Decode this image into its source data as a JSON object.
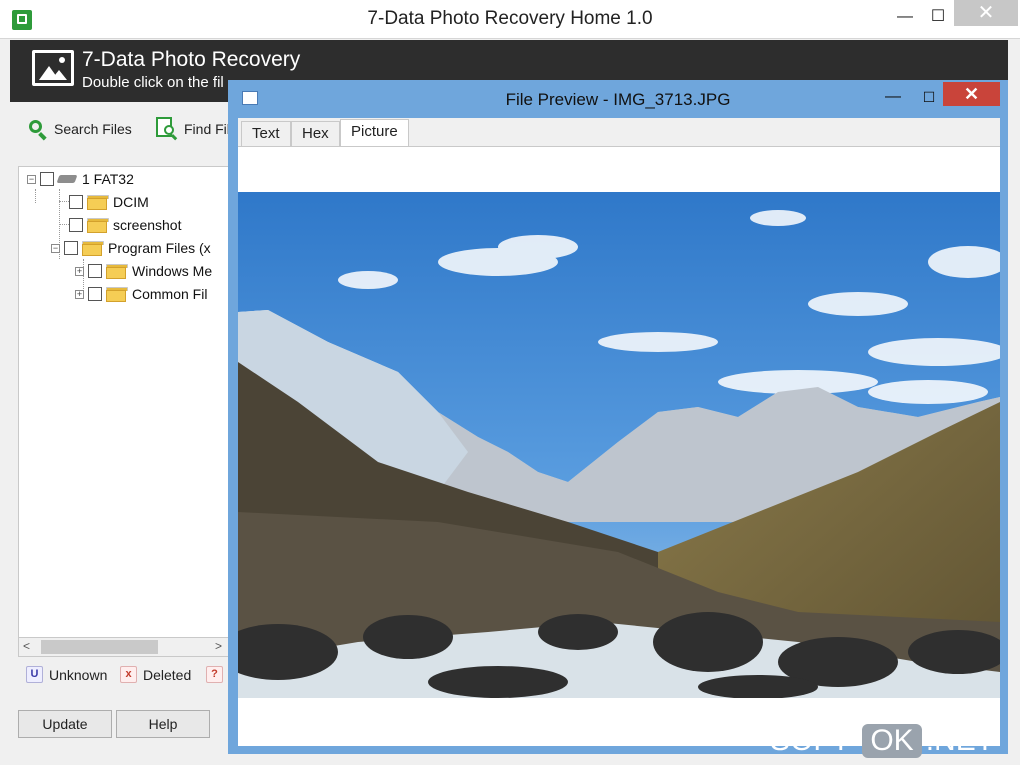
{
  "main_window": {
    "title": "7-Data Photo Recovery Home 1.0",
    "controls": {
      "minimize": "—",
      "maximize": "☐",
      "close": "✕"
    }
  },
  "banner": {
    "title": "7-Data Photo Recovery",
    "subtitle": "Double click on the fil"
  },
  "toolbar": {
    "search_files": "Search Files",
    "find_files": "Find Fil"
  },
  "tree": {
    "items": [
      {
        "label": "1 FAT32",
        "level": 0,
        "type": "drive",
        "expander": "−"
      },
      {
        "label": "DCIM",
        "level": 1,
        "type": "folder"
      },
      {
        "label": "screenshot",
        "level": 1,
        "type": "folder"
      },
      {
        "label": "Program Files (x",
        "level": 1,
        "type": "folder",
        "expander": "−"
      },
      {
        "label": "Windows Me",
        "level": 2,
        "type": "folder",
        "expander": "+"
      },
      {
        "label": "Common Fil",
        "level": 2,
        "type": "folder",
        "expander": "+"
      }
    ]
  },
  "scrollbar": {
    "left_arrow": "<",
    "right_arrow": ">"
  },
  "legend": {
    "unknown": {
      "badge": "U",
      "label": "Unknown",
      "color": "#3a3aa8"
    },
    "deleted": {
      "badge": "x",
      "label": "Deleted",
      "color": "#c23a2a"
    },
    "other": {
      "badge": "?",
      "color": "#c23a2a"
    }
  },
  "buttons": {
    "update": "Update",
    "help": "Help"
  },
  "preview_window": {
    "title": "File Preview - IMG_3713.JPG",
    "controls": {
      "minimize": "—",
      "maximize": "☐",
      "close": "✕"
    },
    "tabs": [
      {
        "label": "Text",
        "active": false
      },
      {
        "label": "Hex",
        "active": false
      },
      {
        "label": "Picture",
        "active": true
      }
    ],
    "accent_color": "#6fa6dc"
  },
  "watermark": {
    "part1": "SOFT-",
    "part2": "OK",
    "part3": ".NET"
  }
}
